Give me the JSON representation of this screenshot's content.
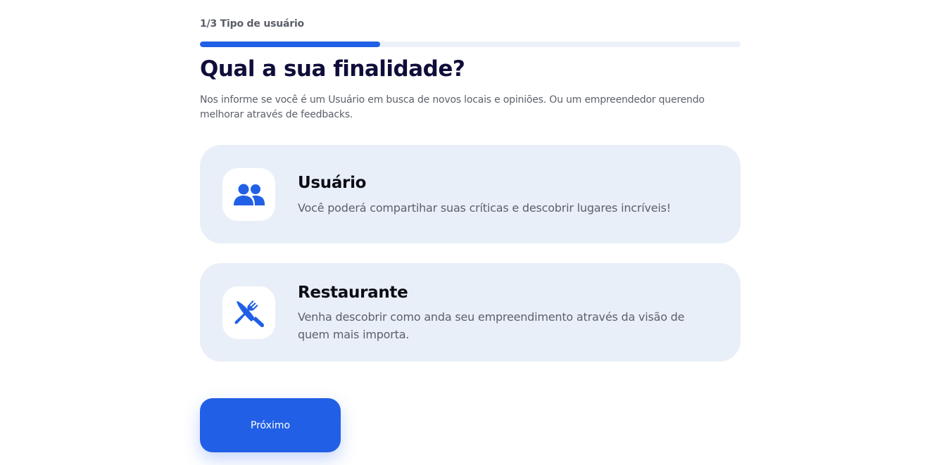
{
  "step": {
    "label": "1/3 Tipo de usuário",
    "progress_fraction": 0.333
  },
  "heading": "Qual a sua finalidade?",
  "description": "Nos informe se você é um Usuário em busca de novos locais e opiniões. Ou um empreendedor querendo melhorar através de feedbacks.",
  "options": [
    {
      "title": "Usuário",
      "text": "Você poderá compartihar suas críticas e descobrir lugares incríveis!",
      "icon": "users-icon"
    },
    {
      "title": "Restaurante",
      "text": "Venha descobrir como anda seu empreendimento através da visão de quem mais importa.",
      "icon": "utensils-crossed-icon"
    }
  ],
  "next_button": "Próximo",
  "colors": {
    "primary": "#2160e6",
    "card_bg": "#e9eff8",
    "heading": "#0f0d3a",
    "progress_track": "#ecf1f9"
  }
}
